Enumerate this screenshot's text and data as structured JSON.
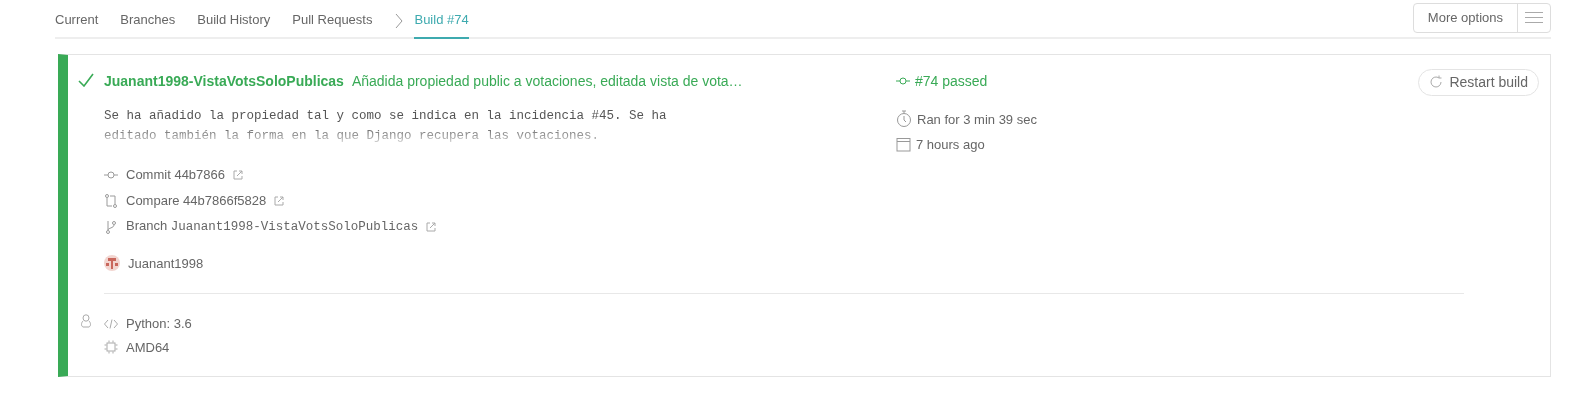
{
  "tabs": [
    {
      "label": "Current",
      "selected": false
    },
    {
      "label": "Branches",
      "selected": false
    },
    {
      "label": "Build History",
      "selected": false
    },
    {
      "label": "Pull Requests",
      "selected": false
    },
    {
      "label": "Build #74",
      "selected": true
    }
  ],
  "more_options": {
    "label": "More options"
  },
  "build": {
    "passed": true,
    "branch": "Juanant1998-VistaVotsSoloPublicas",
    "message": "Añadida propiedad public a votaciones, editada vista de vota…",
    "description": "Se ha añadido la propiedad tal y como se indica en la incidencia #45. Se ha editado también la forma en la que Django recupera las votaciones.",
    "state": "#74 passed",
    "duration": "Ran for 3 min 39 sec",
    "finished": "7 hours ago",
    "restart": "Restart build",
    "links": [
      {
        "kind": "commit",
        "label": "Commit",
        "value": "44b7866"
      },
      {
        "kind": "compare",
        "label": "Compare",
        "value": "44b7866f5828"
      },
      {
        "kind": "branch",
        "label": "Branch",
        "value": "Juanant1998-VistaVotsSoloPublicas"
      }
    ],
    "author": "Juanant1998",
    "language": "Python: 3.6",
    "arch": "AMD64"
  }
}
